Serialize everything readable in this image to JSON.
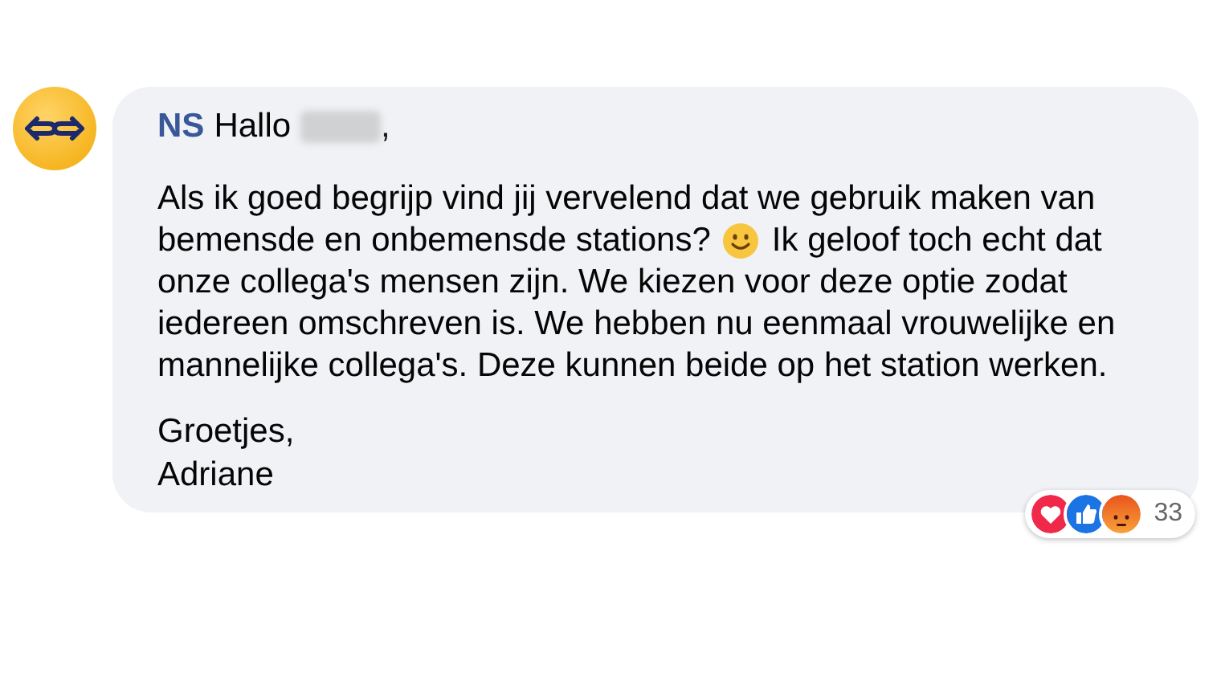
{
  "comment": {
    "author": "NS",
    "greeting": "Hallo",
    "name_redacted": true,
    "greeting_end": ",",
    "lines": [
      [
        {
          "kind": "text",
          "text": "Als ik goed begrijp vind jij vervelend dat we gebruik maken van"
        }
      ],
      [
        {
          "kind": "text",
          "text": "bemensde en onbemensde stations?"
        },
        {
          "kind": "emoji"
        },
        {
          "kind": "text",
          "text": "Ik geloof toch echt dat"
        }
      ],
      [
        {
          "kind": "text",
          "text": "onze collega's mensen zijn. We kiezen voor deze optie zodat"
        }
      ],
      [
        {
          "kind": "text",
          "text": "iedereen omschreven is. We hebben nu eenmaal vrouwelijke en"
        }
      ],
      [
        {
          "kind": "text",
          "text": "mannelijke collega's. Deze kunnen beide op het station werken."
        }
      ]
    ],
    "signoff": [
      "Groetjes,",
      "Adriane"
    ],
    "reactions": {
      "types": [
        {
          "kind": "love"
        },
        {
          "kind": "like"
        },
        {
          "kind": "angry"
        }
      ],
      "count": "33"
    }
  }
}
